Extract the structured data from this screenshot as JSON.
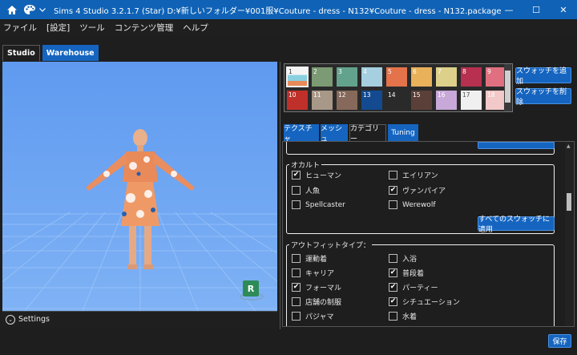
{
  "titlebar": {
    "title": "Sims 4 Studio 3.2.1.7 (Star)  D:¥新しいフォルダー¥001服¥Couture - dress - N132¥Couture - dress - N132.package",
    "minimize": "—",
    "maximize": "☐",
    "close": "✕",
    "icons": [
      "home-icon",
      "palette-icon",
      "chevron-down-icon"
    ]
  },
  "menu": [
    "ファイル",
    "[設定]",
    "ツール",
    "コンテンツ管理",
    "ヘルプ"
  ],
  "left_tabs": {
    "studio": "Studio",
    "warehouse": "Warehouse"
  },
  "viewport": {
    "badge": "R",
    "settings_label": "Settings",
    "colors": {
      "background": "#5c97e8",
      "badge": "#2e8b57"
    }
  },
  "swatches": [
    {
      "num": "1",
      "color": "#8ad0e0",
      "selected": true
    },
    {
      "num": "2",
      "color": "#7c9a73"
    },
    {
      "num": "3",
      "color": "#63a38e"
    },
    {
      "num": "4",
      "color": "#a6cfe0"
    },
    {
      "num": "5",
      "color": "#e4724a"
    },
    {
      "num": "6",
      "color": "#e8b15a"
    },
    {
      "num": "7",
      "color": "#ddd08a"
    },
    {
      "num": "8",
      "color": "#b83050"
    },
    {
      "num": "9",
      "color": "#e07080"
    },
    {
      "num": "10",
      "color": "#c0302a"
    },
    {
      "num": "11",
      "color": "#a89888"
    },
    {
      "num": "12",
      "color": "#86695a"
    },
    {
      "num": "13",
      "color": "#134a90"
    },
    {
      "num": "14",
      "color": "#2a2a2a"
    },
    {
      "num": "15",
      "color": "#5a4038"
    },
    {
      "num": "16",
      "color": "#c8a8d8"
    },
    {
      "num": "17",
      "color": "#f0f0f0"
    },
    {
      "num": "18",
      "color": "#f2c8c8"
    }
  ],
  "swatch_buttons": {
    "add": "スウォッチを追加",
    "remove": "スウォッチを削除"
  },
  "right_tabs": [
    "テクスチャ",
    "メッシュ",
    "カテゴリー",
    "Tuning"
  ],
  "occult": {
    "label": "オカルト",
    "items": [
      {
        "label": "ヒューマン",
        "checked": true
      },
      {
        "label": "エイリアン",
        "checked": false
      },
      {
        "label": "人魚",
        "checked": false
      },
      {
        "label": "ヴァンパイア",
        "checked": true
      },
      {
        "label": "Spellcaster",
        "checked": false
      },
      {
        "label": "Werewolf",
        "checked": false
      }
    ],
    "apply_button": "すべてのスウォッチに適用"
  },
  "outfit": {
    "label": "アウトフィットタイプ：",
    "items": [
      {
        "label": "運動着",
        "checked": false
      },
      {
        "label": "入浴",
        "checked": false
      },
      {
        "label": "キャリア",
        "checked": false
      },
      {
        "label": "普段着",
        "checked": true
      },
      {
        "label": "フォーマル",
        "checked": true
      },
      {
        "label": "パーティー",
        "checked": true
      },
      {
        "label": "店舗の制服",
        "checked": false
      },
      {
        "label": "シチュエーション",
        "checked": true
      },
      {
        "label": "パジャマ",
        "checked": false
      },
      {
        "label": "水着",
        "checked": false
      }
    ]
  },
  "save_button": "保存",
  "check_glyph": "✔"
}
